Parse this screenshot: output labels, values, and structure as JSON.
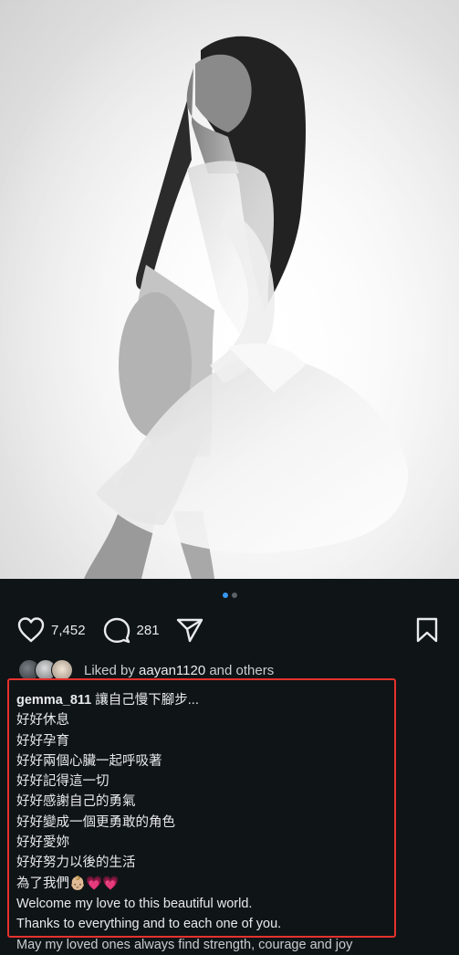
{
  "post": {
    "image_alt": "Black and white maternity portrait of a woman in a sheer white dress"
  },
  "carousel": {
    "count": 2,
    "active": 0
  },
  "actions": {
    "likes": "7,452",
    "comments": "281"
  },
  "liked_by": {
    "prefix": "Liked by ",
    "user": "aayan1120",
    "suffix": " and others"
  },
  "caption": {
    "username": "gemma_811",
    "first_line": "讓自己慢下腳步...",
    "lines": [
      "好好休息",
      "好好孕育",
      "好好兩個心臟一起呼吸著",
      "好好記得這一切",
      "好好感謝自己的勇氣",
      "好好變成一個更勇敢的角色",
      "好好愛妳",
      "好好努力以後的生活",
      "為了我們👶🏼💗💗",
      "Welcome my love to this beautiful world.",
      "Thanks to everything and to each one of you."
    ],
    "cut_off_line": "May my loved ones always find strength, courage and joy"
  },
  "colors": {
    "background": "#0f1417",
    "highlight_border": "#e5322d",
    "active_dot": "#3897f0"
  }
}
